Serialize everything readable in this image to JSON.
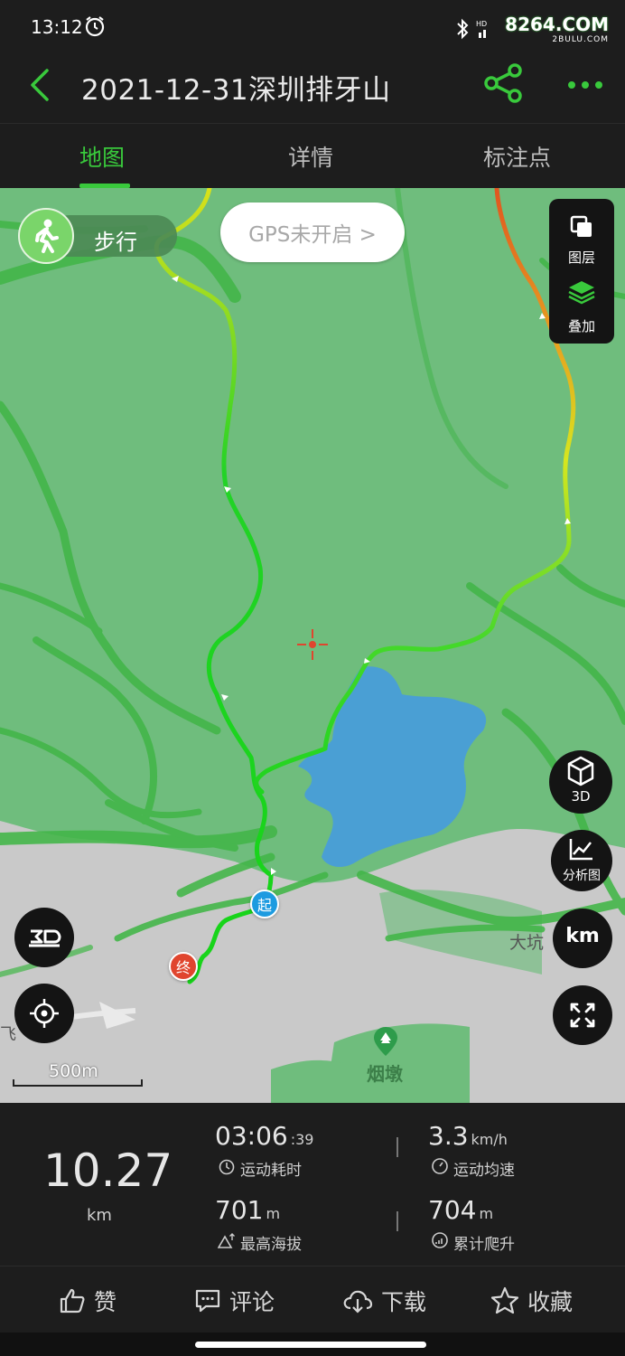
{
  "status_bar": {
    "time": "13:12",
    "brand": "8264.COM",
    "brand_sub": "2BULU.COM",
    "icons": [
      "alarm-icon",
      "bluetooth-icon",
      "hd-signal-icon"
    ]
  },
  "header": {
    "title": "2021-12-31深圳排牙山",
    "icons": [
      "back-arrow-icon",
      "share-icon",
      "more-dots-icon"
    ],
    "accent_color": "#39c93c"
  },
  "tabs": [
    {
      "label": "地图",
      "active": true
    },
    {
      "label": "详情",
      "active": false
    },
    {
      "label": "标注点",
      "active": false
    }
  ],
  "map": {
    "mode_label": "步行",
    "gps_text": "GPS未开启 >",
    "layers_label": "图层",
    "overlay_label": "叠加",
    "view3d_label": "3D",
    "analysis_label": "分析图",
    "unit_label": "km",
    "places": {
      "dakeng": "大坑",
      "yandun": "烟墩",
      "fei": "飞"
    },
    "scale": "500m",
    "start_marker": "起",
    "end_marker": "终",
    "colors": {
      "forest": "#6fbd7d",
      "water": "#4a9fd4",
      "road_green": "#43b649",
      "start": "#1d9be0",
      "end": "#e0452e"
    }
  },
  "stats": {
    "distance": "10.27",
    "distance_unit": "km",
    "duration": "03:06",
    "duration_sec": ":39",
    "duration_label": "运动耗时",
    "avg_speed": "3.3",
    "avg_speed_unit": "km/h",
    "avg_speed_label": "运动均速",
    "max_alt": "701",
    "max_alt_unit": "m",
    "max_alt_label": "最高海拔",
    "climb": "704",
    "climb_unit": "m",
    "climb_label": "累计爬升"
  },
  "actions": {
    "like": "赞",
    "comment": "评论",
    "download": "下载",
    "favorite": "收藏"
  }
}
